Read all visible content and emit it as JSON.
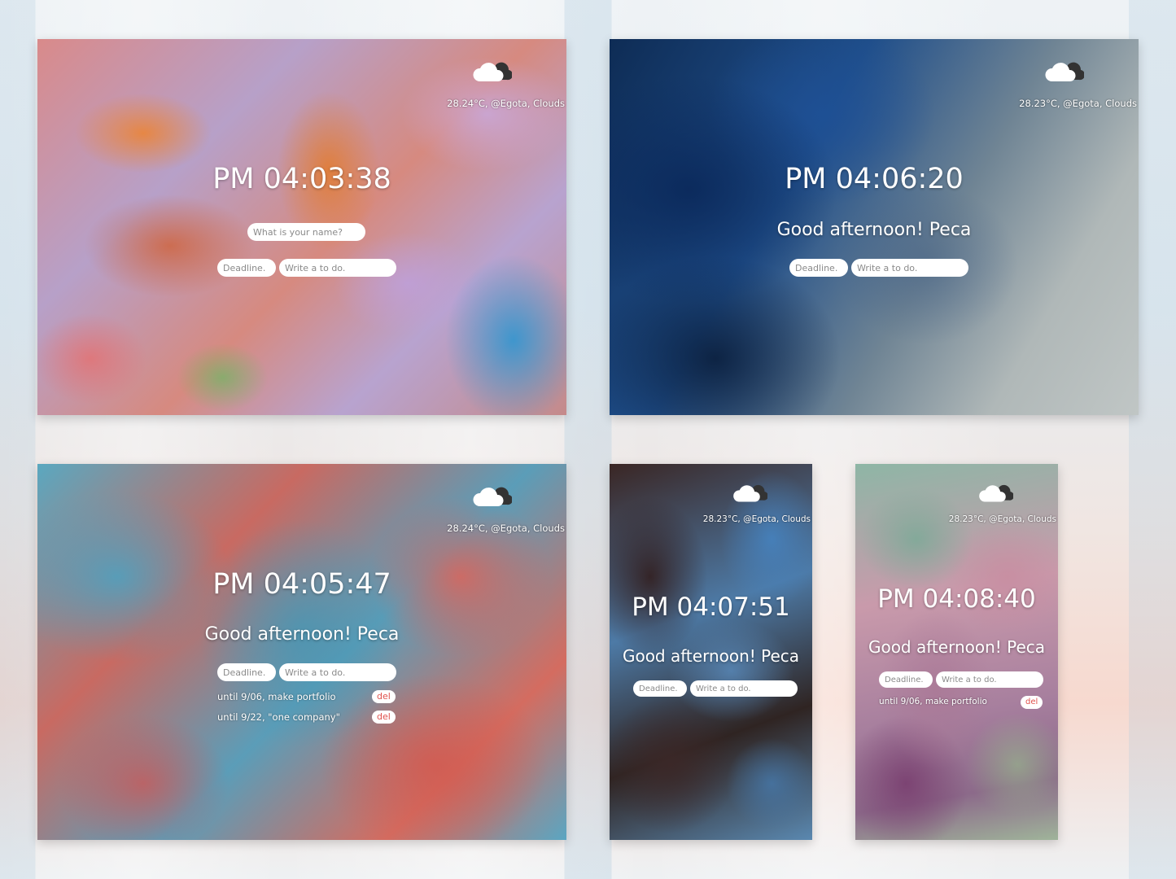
{
  "screens": [
    {
      "weather": "28.24°C, @Egota, Clouds",
      "clock": "PM 04:03:38",
      "name_placeholder": "What is your name?",
      "deadline_placeholder": "Deadline.",
      "todo_placeholder": "Write a to do."
    },
    {
      "weather": "28.23°C, @Egota, Clouds",
      "clock": "PM 04:06:20",
      "greeting": "Good afternoon! Peca",
      "deadline_placeholder": "Deadline.",
      "todo_placeholder": "Write a to do."
    },
    {
      "weather": "28.24°C, @Egota, Clouds",
      "clock": "PM 04:05:47",
      "greeting": "Good afternoon! Peca",
      "deadline_placeholder": "Deadline.",
      "todo_placeholder": "Write a to do.",
      "todos": [
        {
          "text": "until 9/06, make portfolio",
          "del": "del"
        },
        {
          "text": "until 9/22, \"one company\"",
          "del": "del"
        }
      ]
    },
    {
      "weather": "28.23°C, @Egota, Clouds",
      "clock": "PM 04:07:51",
      "greeting": "Good afternoon! Peca",
      "deadline_placeholder": "Deadline.",
      "todo_placeholder": "Write a to do."
    },
    {
      "weather": "28.23°C, @Egota, Clouds",
      "clock": "PM 04:08:40",
      "greeting": "Good afternoon! Peca",
      "deadline_placeholder": "Deadline.",
      "todo_placeholder": "Write a to do.",
      "todos": [
        {
          "text": "until 9/06, make portfolio",
          "del": "del"
        }
      ]
    }
  ],
  "weather_icon": "cloud-icon"
}
